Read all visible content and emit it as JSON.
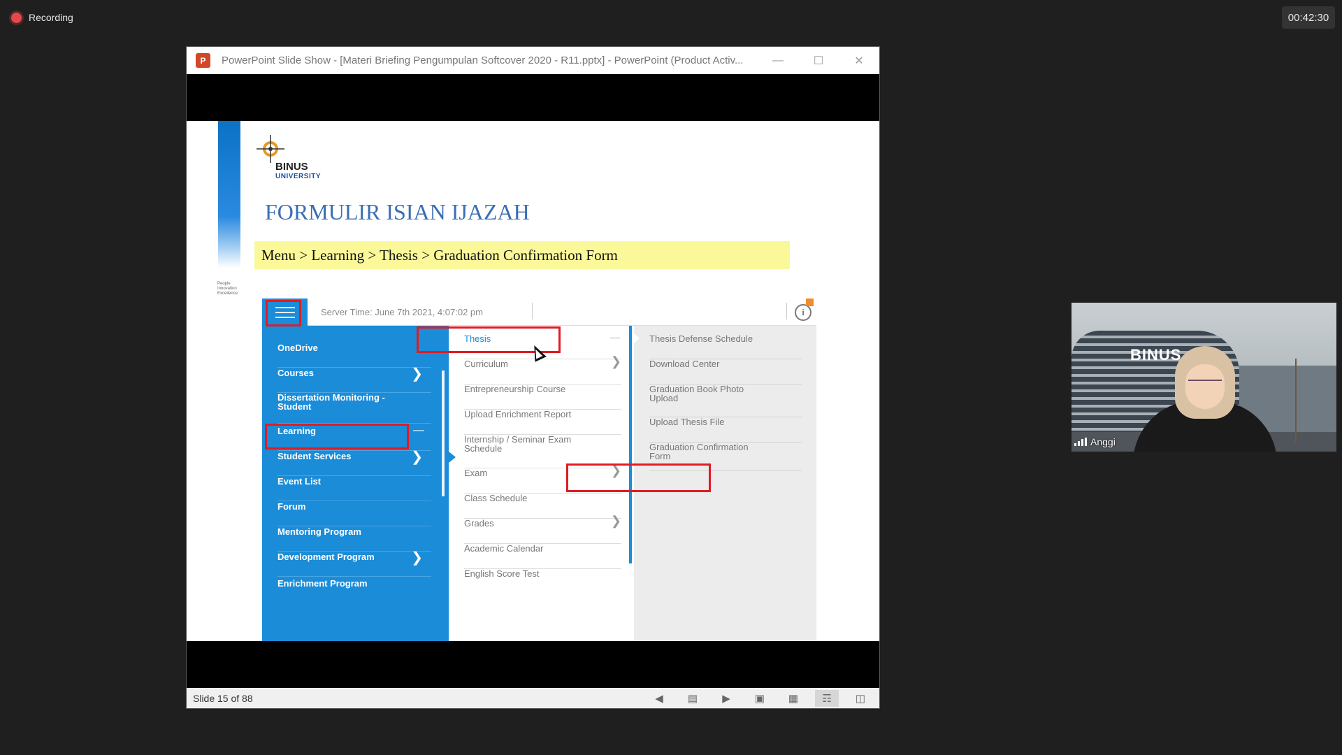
{
  "recording": {
    "label": "Recording"
  },
  "timer": "00:42:30",
  "ppt": {
    "title": "PowerPoint Slide Show - [Materi Briefing Pengumpulan Softcover 2020 - R11.pptx] - PowerPoint (Product Activ...",
    "app_icon": "P",
    "status": {
      "slide_counter": "Slide 15 of 88"
    }
  },
  "slide": {
    "logo_name": "BINUS",
    "logo_sub": "UNIVERSITY",
    "side_tag": "People Innovation Excellence",
    "title": "FORMULIR ISIAN IJAZAH",
    "breadcrumb": "Menu > Learning > Thesis > Graduation Confirmation Form",
    "screenshot": {
      "server_time": "Server Time: June 7th 2021, 4:07:02 pm",
      "menu": [
        {
          "label": "OneDrive"
        },
        {
          "label": "Courses"
        },
        {
          "label": "Dissertation Monitoring - Student"
        },
        {
          "label": "Learning"
        },
        {
          "label": "Student Services"
        },
        {
          "label": "Event List"
        },
        {
          "label": "Forum"
        },
        {
          "label": "Mentoring Program"
        },
        {
          "label": "Development Program"
        },
        {
          "label": "Enrichment Program"
        }
      ],
      "submenu": [
        {
          "label": "Thesis"
        },
        {
          "label": "Curriculum"
        },
        {
          "label": "Entrepreneurship Course"
        },
        {
          "label": "Upload Enrichment Report"
        },
        {
          "label": "Internship / Seminar Exam Schedule"
        },
        {
          "label": "Exam"
        },
        {
          "label": "Class Schedule"
        },
        {
          "label": "Grades"
        },
        {
          "label": "Academic Calendar"
        },
        {
          "label": "English Score Test"
        }
      ],
      "thesis_menu": [
        {
          "label": "Thesis Defense Schedule"
        },
        {
          "label": "Download Center"
        },
        {
          "label": "Graduation Book Photo Upload"
        },
        {
          "label": "Upload Thesis File"
        },
        {
          "label": "Graduation Confirmation Form"
        }
      ]
    }
  },
  "participant": {
    "name": "Anggi",
    "background_sign": "BINUS"
  },
  "icons": {
    "recording": "record-dot-icon",
    "window_controls": [
      "minimize-icon",
      "maximize-icon",
      "close-icon"
    ],
    "statusbar": [
      "previous-icon",
      "slide-notes-icon",
      "next-icon",
      "normal-view-icon",
      "slide-sorter-icon",
      "reading-view-icon",
      "slideshow-icon"
    ]
  },
  "colors": {
    "menu_blue": "#1b8cd8",
    "highlight_red": "#e01b24",
    "title_blue": "#3a6eb4",
    "breadcrumb_yellow": "#fbf89a"
  }
}
